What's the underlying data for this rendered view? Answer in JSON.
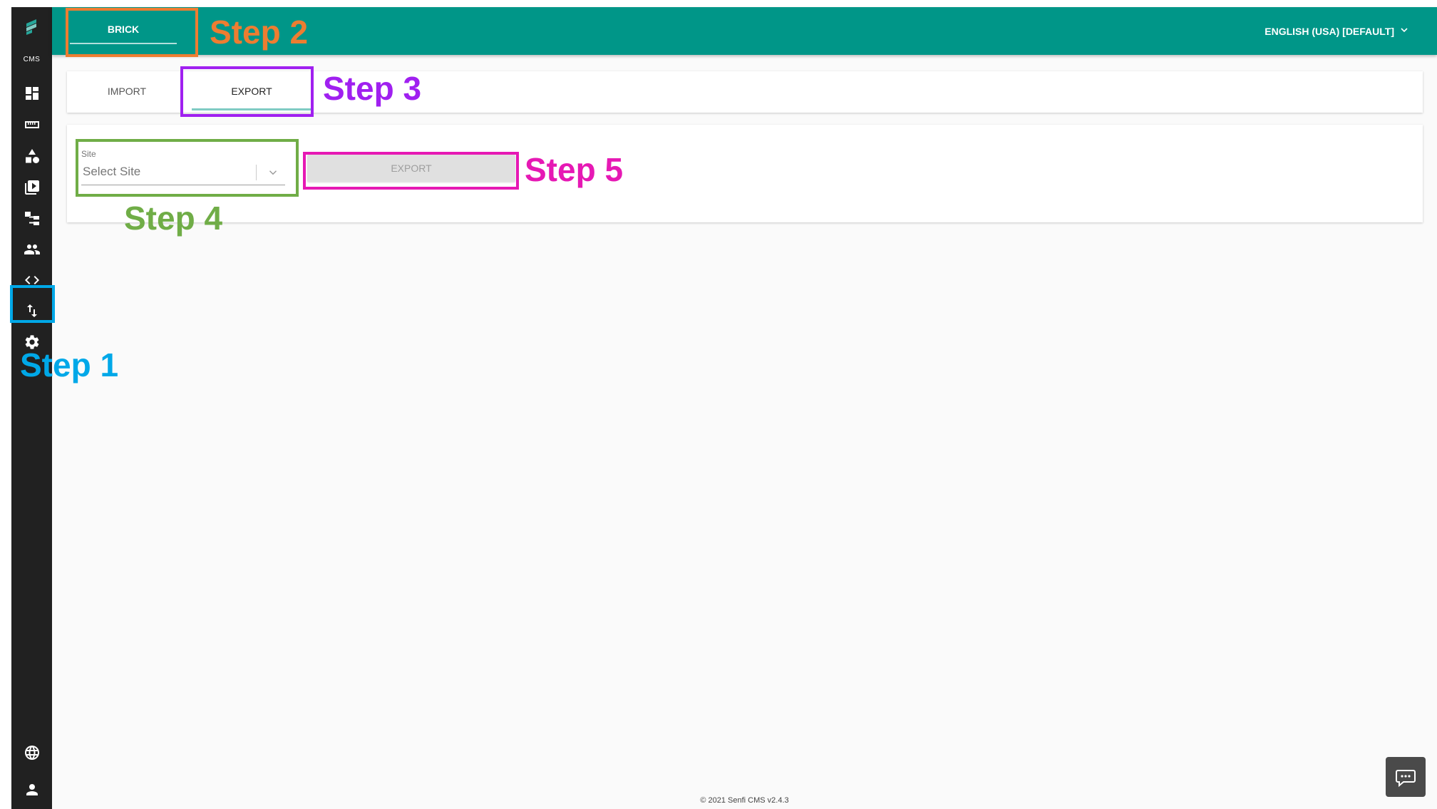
{
  "sidebar": {
    "logo_text": "CMS",
    "icons": [
      "logo-icon",
      "dashboard-icon",
      "ruler-icon",
      "shapes-icon",
      "media-library-icon",
      "sitemap-icon",
      "people-icon",
      "code-icon",
      "import-export-icon",
      "gear-icon",
      "globe-icon",
      "user-icon"
    ]
  },
  "topbar": {
    "brick_tab": "BRICK",
    "language": "ENGLISH (USA) [DEFAULT]"
  },
  "tabs": [
    {
      "label": "IMPORT",
      "active": false
    },
    {
      "label": "EXPORT",
      "active": true
    }
  ],
  "export_form": {
    "site_label": "Site",
    "site_placeholder": "Select Site",
    "export_button": "EXPORT"
  },
  "annotations": [
    {
      "label": "Step 1",
      "color": "#00a8e8"
    },
    {
      "label": "Step 2",
      "color": "#ed7d31"
    },
    {
      "label": "Step 3",
      "color": "#a020f0"
    },
    {
      "label": "Step 4",
      "color": "#70ad47"
    },
    {
      "label": "Step 5",
      "color": "#e619b4"
    }
  ],
  "footer": "© 2021 Senfi CMS v2.4.3",
  "colors": {
    "primary": "#009688",
    "sidebar": "#212121"
  }
}
